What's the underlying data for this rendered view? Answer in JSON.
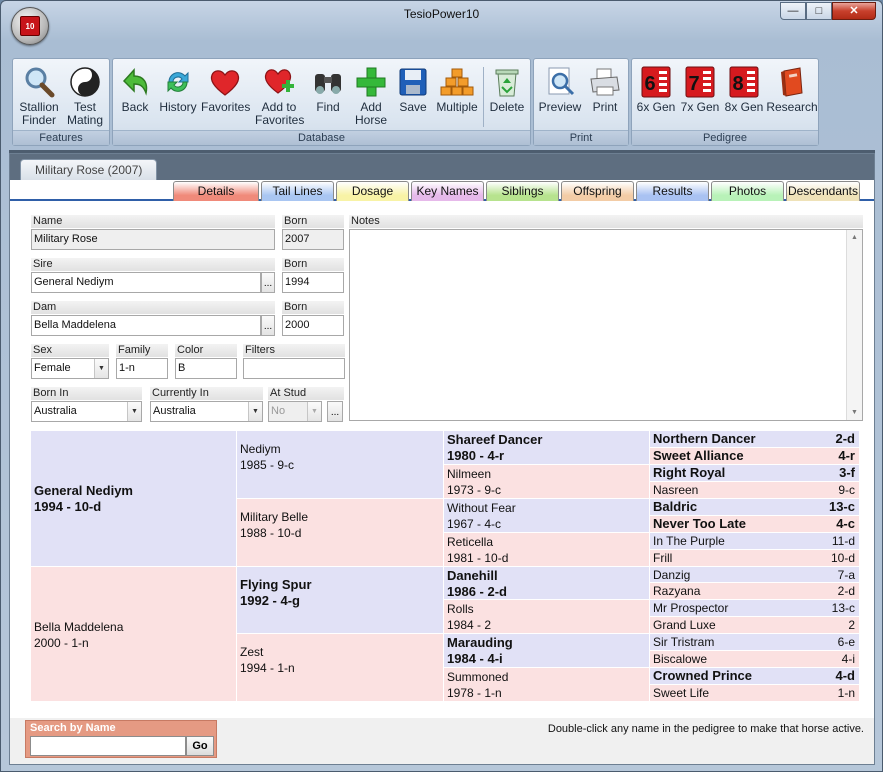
{
  "window": {
    "title": "TesioPower10",
    "icon_label": "10"
  },
  "ribbon": {
    "groups": [
      {
        "caption": "Features"
      },
      {
        "caption": "Database"
      },
      {
        "caption": "Print"
      },
      {
        "caption": "Pedigree"
      }
    ],
    "buttons": {
      "stallion_finder": "Stallion\nFinder",
      "test_mating": "Test\nMating",
      "back": "Back",
      "history": "History",
      "favorites": "Favorites",
      "add_to_favorites": "Add to\nFavorites",
      "find": "Find",
      "add_horse": "Add\nHorse",
      "save": "Save",
      "multiple": "Multiple",
      "delete": "Delete",
      "preview": "Preview",
      "print": "Print",
      "gen6": "6x Gen",
      "gen7": "7x Gen",
      "gen8": "8x Gen",
      "research": "Research"
    },
    "gen_digits": {
      "g6": "6",
      "g7": "7",
      "g8": "8"
    }
  },
  "document_tab": "Military Rose (2007)",
  "tabs": [
    {
      "label": "Details",
      "color": "#f08a7a"
    },
    {
      "label": "Tail Lines",
      "color": "#a9c6f2"
    },
    {
      "label": "Dosage",
      "color": "#f8f3a6"
    },
    {
      "label": "Key Names",
      "color": "#e6b9ea"
    },
    {
      "label": "Siblings",
      "color": "#b7e38e"
    },
    {
      "label": "Offspring",
      "color": "#f3cca6"
    },
    {
      "label": "Results",
      "color": "#a9c2f2"
    },
    {
      "label": "Photos",
      "color": "#b8f2b8"
    },
    {
      "label": "Descendants",
      "color": "#efe2b8"
    }
  ],
  "form": {
    "name_label": "Name",
    "name_value": "Military Rose",
    "born_label": "Born",
    "born_value": "2007",
    "notes_label": "Notes",
    "sire_label": "Sire",
    "sire_value": "General Nediym",
    "sire_born_label": "Born",
    "sire_born_value": "1994",
    "dam_label": "Dam",
    "dam_value": "Bella Maddelena",
    "dam_born_label": "Born",
    "dam_born_value": "2000",
    "sex_label": "Sex",
    "sex_value": "Female",
    "family_label": "Family",
    "family_value": "1-n",
    "color_label": "Color",
    "color_value": "B",
    "filters_label": "Filters",
    "filters_value": "",
    "born_in_label": "Born In",
    "born_in_value": "Australia",
    "currently_in_label": "Currently In",
    "currently_in_value": "Australia",
    "at_stud_label": "At Stud",
    "at_stud_value": "No",
    "ellipsis": "..."
  },
  "pedigree": {
    "gen1": [
      {
        "name": "General Nediym",
        "info": "1994 - 10-d",
        "bold": true,
        "bg": "blue"
      },
      {
        "name": "Bella Maddelena",
        "info": "2000 - 1-n",
        "bold": false,
        "bg": "pink"
      }
    ],
    "gen2": [
      {
        "name": "Nediym",
        "info": "1985 - 9-c",
        "bold": false,
        "bg": "blue"
      },
      {
        "name": "Military Belle",
        "info": "1988 - 10-d",
        "bold": false,
        "bg": "pink"
      },
      {
        "name": "Flying Spur",
        "info": "1992 - 4-g",
        "bold": true,
        "bg": "blue"
      },
      {
        "name": "Zest",
        "info": "1994 - 1-n",
        "bold": false,
        "bg": "pink"
      }
    ],
    "gen3": [
      {
        "name": "Shareef Dancer",
        "info": "1980 - 4-r",
        "bold": true,
        "bg": "blue"
      },
      {
        "name": "Nilmeen",
        "info": "1973 - 9-c",
        "bold": false,
        "bg": "pink"
      },
      {
        "name": "Without Fear",
        "info": "1967 - 4-c",
        "bold": false,
        "bg": "blue"
      },
      {
        "name": "Reticella",
        "info": "1981 - 10-d",
        "bold": false,
        "bg": "pink"
      },
      {
        "name": "Danehill",
        "info": "1986 - 2-d",
        "bold": true,
        "bg": "blue"
      },
      {
        "name": "Rolls",
        "info": "1984 - 2",
        "bold": false,
        "bg": "pink"
      },
      {
        "name": "Marauding",
        "info": "1984 - 4-i",
        "bold": true,
        "bg": "blue"
      },
      {
        "name": "Summoned",
        "info": "1978 - 1-n",
        "bold": false,
        "bg": "pink"
      }
    ],
    "gen4": [
      {
        "name": "Northern Dancer",
        "fam": "2-d",
        "bold": true,
        "bg": "blue"
      },
      {
        "name": "Sweet Alliance",
        "fam": "4-r",
        "bold": true,
        "bg": "pink"
      },
      {
        "name": "Right Royal",
        "fam": "3-f",
        "bold": true,
        "bg": "blue"
      },
      {
        "name": "Nasreen",
        "fam": "9-c",
        "bold": false,
        "bg": "pink"
      },
      {
        "name": "Baldric",
        "fam": "13-c",
        "bold": true,
        "bg": "blue"
      },
      {
        "name": "Never Too Late",
        "fam": "4-c",
        "bold": true,
        "bg": "pink"
      },
      {
        "name": "In The Purple",
        "fam": "11-d",
        "bold": false,
        "bg": "blue"
      },
      {
        "name": "Frill",
        "fam": "10-d",
        "bold": false,
        "bg": "pink"
      },
      {
        "name": "Danzig",
        "fam": "7-a",
        "bold": false,
        "bg": "blue"
      },
      {
        "name": "Razyana",
        "fam": "2-d",
        "bold": false,
        "bg": "pink"
      },
      {
        "name": "Mr Prospector",
        "fam": "13-c",
        "bold": false,
        "bg": "blue"
      },
      {
        "name": "Grand Luxe",
        "fam": "2",
        "bold": false,
        "bg": "pink"
      },
      {
        "name": "Sir Tristram",
        "fam": "6-e",
        "bold": false,
        "bg": "blue"
      },
      {
        "name": "Biscalowe",
        "fam": "4-i",
        "bold": false,
        "bg": "pink"
      },
      {
        "name": "Crowned Prince",
        "fam": "4-d",
        "bold": true,
        "bg": "blue"
      },
      {
        "name": "Sweet Life",
        "fam": "1-n",
        "bold": false,
        "bg": "pink"
      }
    ]
  },
  "search": {
    "label": "Search by Name",
    "value": "",
    "go_label": "Go"
  },
  "hint": "Double-click any name in the pedigree to make that horse active."
}
